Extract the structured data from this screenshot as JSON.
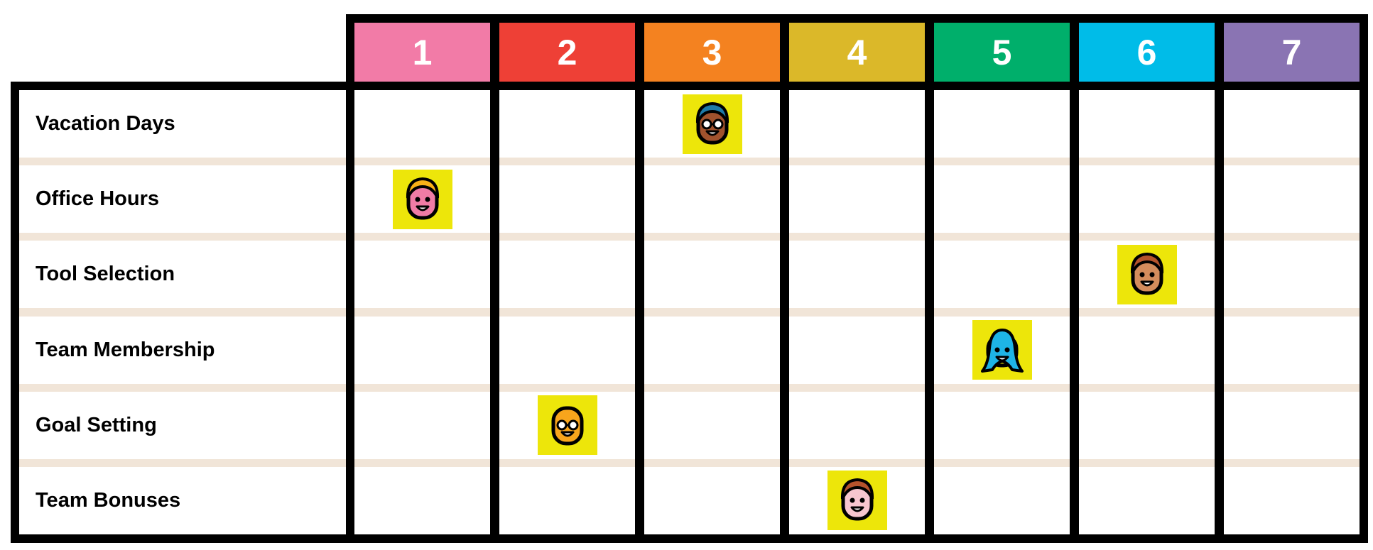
{
  "columns": [
    {
      "label": "1",
      "color": "#F27BA7"
    },
    {
      "label": "2",
      "color": "#EE4036"
    },
    {
      "label": "3",
      "color": "#F48220"
    },
    {
      "label": "4",
      "color": "#DBB829"
    },
    {
      "label": "5",
      "color": "#00AF6B"
    },
    {
      "label": "6",
      "color": "#00BCE8"
    },
    {
      "label": "7",
      "color": "#8A74B3"
    }
  ],
  "rows": [
    {
      "label": "Vacation Days",
      "column": 3,
      "avatar": {
        "skin": "#A0522D",
        "hair": "#1F7BA8",
        "glasses": true,
        "long_hair": false
      }
    },
    {
      "label": "Office Hours",
      "column": 1,
      "avatar": {
        "skin": "#F07CA5",
        "hair": "#F8B017",
        "glasses": false,
        "long_hair": false
      }
    },
    {
      "label": "Tool Selection",
      "column": 6,
      "avatar": {
        "skin": "#D38C5C",
        "hair": "#B5532C",
        "glasses": false,
        "long_hair": false
      }
    },
    {
      "label": "Team Membership",
      "column": 5,
      "avatar": {
        "skin": "#EDE60A",
        "hair": "#1EB4E6",
        "glasses": false,
        "long_hair": true
      }
    },
    {
      "label": "Goal Setting",
      "column": 2,
      "avatar": {
        "skin": "#F8A51C",
        "hair": null,
        "glasses": true,
        "long_hair": false
      }
    },
    {
      "label": "Team Bonuses",
      "column": 4,
      "avatar": {
        "skin": "#F7C6CF",
        "hair": "#B5532C",
        "glasses": false,
        "long_hair": false
      }
    }
  ],
  "colors": {
    "row_separator": "#F1E5D8",
    "avatar_background": "#EDE60A",
    "border": "#000000"
  }
}
